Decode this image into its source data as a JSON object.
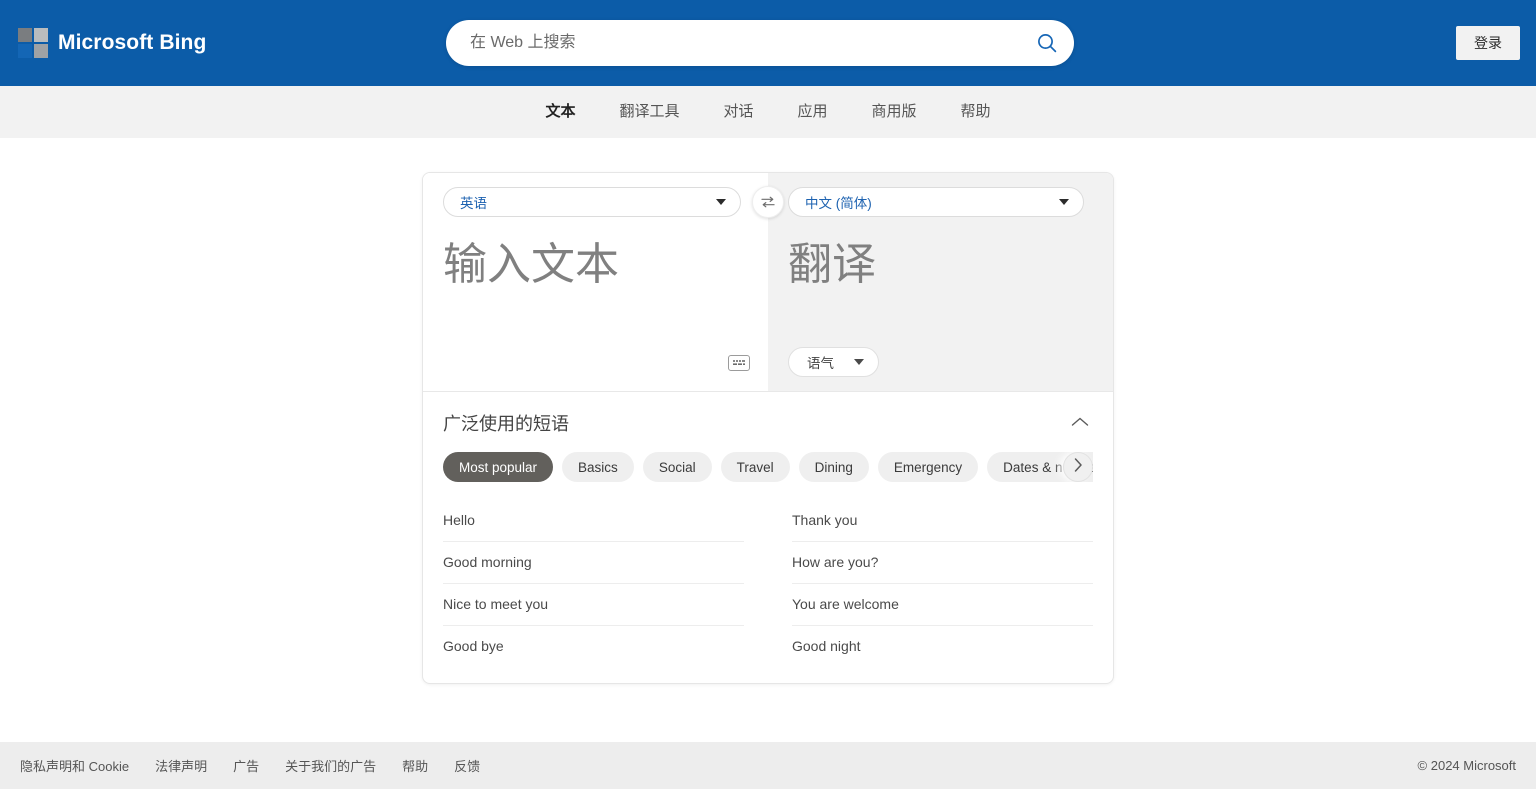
{
  "header": {
    "brand": "Microsoft Bing",
    "logo_icon": "microsoft-squares-icon",
    "search": {
      "value": "",
      "placeholder": "在 Web 上搜索",
      "icon": "search-icon"
    },
    "signin_label": "登录",
    "background_color": "#0c5ca8"
  },
  "nav": {
    "tabs": [
      {
        "label": "文本",
        "active": true
      },
      {
        "label": "翻译工具",
        "active": false
      },
      {
        "label": "对话",
        "active": false
      },
      {
        "label": "应用",
        "active": false
      },
      {
        "label": "商用版",
        "active": false
      },
      {
        "label": "帮助",
        "active": false
      }
    ]
  },
  "translator": {
    "source": {
      "language": "英语",
      "placeholder": "输入文本",
      "text": "",
      "keyboard_icon": "keyboard-icon",
      "caret_icon": "chevron-down-icon"
    },
    "target": {
      "language": "中文 (简体)",
      "placeholder": "翻译",
      "text": "",
      "tone_label": "语气",
      "caret_icon": "chevron-down-icon"
    },
    "swap_icon": "swap-arrows-icon"
  },
  "phrases": {
    "title": "广泛使用的短语",
    "collapse_icon": "chevron-up-icon",
    "next_icon": "chevron-right-icon",
    "categories": [
      {
        "label": "Most popular",
        "active": true
      },
      {
        "label": "Basics",
        "active": false
      },
      {
        "label": "Social",
        "active": false
      },
      {
        "label": "Travel",
        "active": false
      },
      {
        "label": "Dining",
        "active": false
      },
      {
        "label": "Emergency",
        "active": false
      },
      {
        "label": "Dates & numbers",
        "active": false
      }
    ],
    "column_left": [
      "Hello",
      "Good morning",
      "Nice to meet you",
      "Good bye"
    ],
    "column_right": [
      "Thank you",
      "How are you?",
      "You are welcome",
      "Good night"
    ]
  },
  "footer": {
    "links": [
      "隐私声明和 Cookie",
      "法律声明",
      "广告",
      "关于我们的广告",
      "帮助",
      "反馈"
    ],
    "copyright": "© 2024 Microsoft"
  },
  "colors": {
    "header_blue": "#0c5ca8",
    "nav_gray": "#f2f2f2",
    "link_blue": "#1d62b0",
    "chip_active": "#62605c",
    "footer_gray": "#ededed"
  }
}
